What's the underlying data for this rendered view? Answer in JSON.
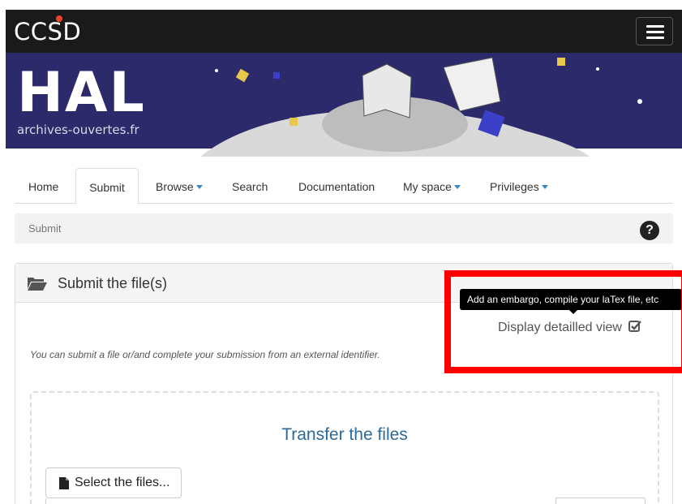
{
  "topbar": {
    "logo_text": "CCSD",
    "menu_icon": "hamburger-icon"
  },
  "banner": {
    "logo_text": "HAL",
    "subtitle": "archives-ouvertes.fr"
  },
  "tabs": [
    {
      "label": "Home",
      "dropdown": false,
      "active": false
    },
    {
      "label": "Submit",
      "dropdown": false,
      "active": true
    },
    {
      "label": "Browse",
      "dropdown": true,
      "active": false
    },
    {
      "label": "Search",
      "dropdown": false,
      "active": false
    },
    {
      "label": "Documentation",
      "dropdown": false,
      "active": false
    },
    {
      "label": "My space",
      "dropdown": true,
      "active": false
    },
    {
      "label": "Privileges",
      "dropdown": true,
      "active": false
    }
  ],
  "breadcrumb": {
    "label": "Submit",
    "help_icon": "question-circle-icon"
  },
  "panel": {
    "title": "Submit the file(s)",
    "info_text": "You can submit a file or/and complete your submission from an external identifier.",
    "detail_view_label": "Display detailled view",
    "dropzone_title": "Transfer the files",
    "select_button_label": "Select the files..."
  },
  "tooltip": {
    "text": "Add an embargo, compile your laTex file, etc"
  },
  "colors": {
    "topbar": "#1a1a1a",
    "banner": "#2d2a6b",
    "link_caret": "#3a87c8",
    "dropzone_title": "#2b6a9a",
    "highlight": "#ff0000"
  }
}
